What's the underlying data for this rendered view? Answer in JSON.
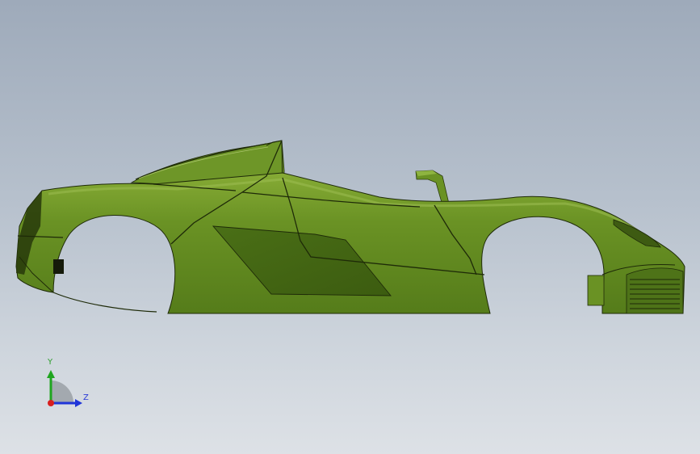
{
  "viewport": {
    "model": "car-body-side-view",
    "colors": {
      "body": "#5f8a1f",
      "body_light": "#7ea32f",
      "body_dark": "#3f6314",
      "edge": "#1e2a08"
    }
  },
  "triad": {
    "y_label": "Y",
    "z_label": "Z",
    "colors": {
      "y": "#1fa51f",
      "z": "#1f35d8",
      "x": "#d81f1f"
    }
  }
}
